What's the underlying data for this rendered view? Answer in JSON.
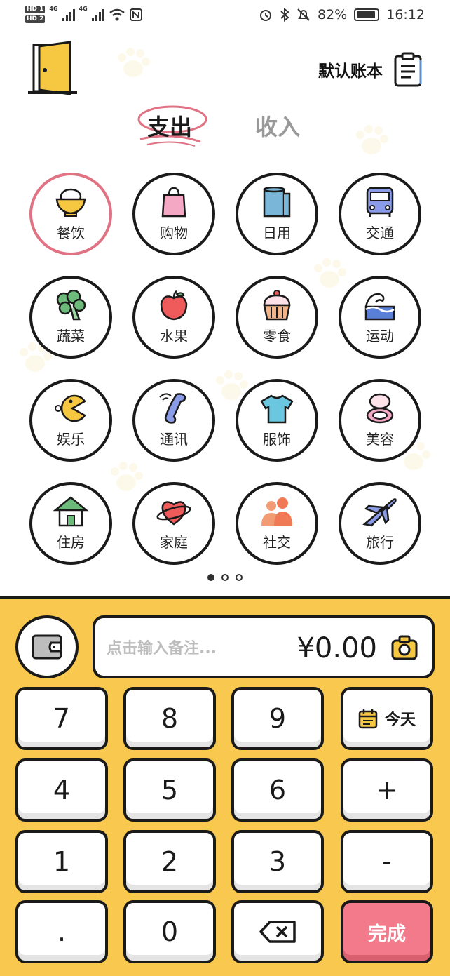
{
  "status_bar": {
    "sim1": "HD 1",
    "sim2": "HD 2",
    "network1": "4G",
    "network2": "4G",
    "battery": "82%",
    "time": "16:12"
  },
  "header": {
    "ledger_label": "默认账本"
  },
  "tabs": {
    "expense": "支出",
    "income": "收入",
    "active": "expense"
  },
  "categories": [
    {
      "label": "餐饮",
      "icon": "rice-bowl-icon",
      "active": true
    },
    {
      "label": "购物",
      "icon": "shopping-bag-icon"
    },
    {
      "label": "日用",
      "icon": "toilet-paper-icon"
    },
    {
      "label": "交通",
      "icon": "bus-icon"
    },
    {
      "label": "蔬菜",
      "icon": "broccoli-icon"
    },
    {
      "label": "水果",
      "icon": "apple-icon"
    },
    {
      "label": "零食",
      "icon": "cupcake-icon"
    },
    {
      "label": "运动",
      "icon": "swimming-wave-icon"
    },
    {
      "label": "娱乐",
      "icon": "pacman-icon"
    },
    {
      "label": "通讯",
      "icon": "phone-icon"
    },
    {
      "label": "服饰",
      "icon": "tshirt-icon"
    },
    {
      "label": "美容",
      "icon": "compact-mirror-icon"
    },
    {
      "label": "住房",
      "icon": "house-icon"
    },
    {
      "label": "家庭",
      "icon": "heart-planet-icon"
    },
    {
      "label": "社交",
      "icon": "people-icon"
    },
    {
      "label": "旅行",
      "icon": "airplane-icon"
    }
  ],
  "pager": {
    "pages": 3,
    "current": 1
  },
  "entry": {
    "note_placeholder": "点击输入备注...",
    "amount": "¥0.00"
  },
  "keypad": {
    "k7": "7",
    "k8": "8",
    "k9": "9",
    "today": "今天",
    "k4": "4",
    "k5": "5",
    "k6": "6",
    "plus": "+",
    "k1": "1",
    "k2": "2",
    "k3": "3",
    "minus": "-",
    "dot": ".",
    "k0": "0",
    "done": "完成"
  },
  "colors": {
    "panel": "#f9c94f",
    "active_ring": "#e07284",
    "done_button": "#f27a8a",
    "inactive_tab": "#999999"
  }
}
